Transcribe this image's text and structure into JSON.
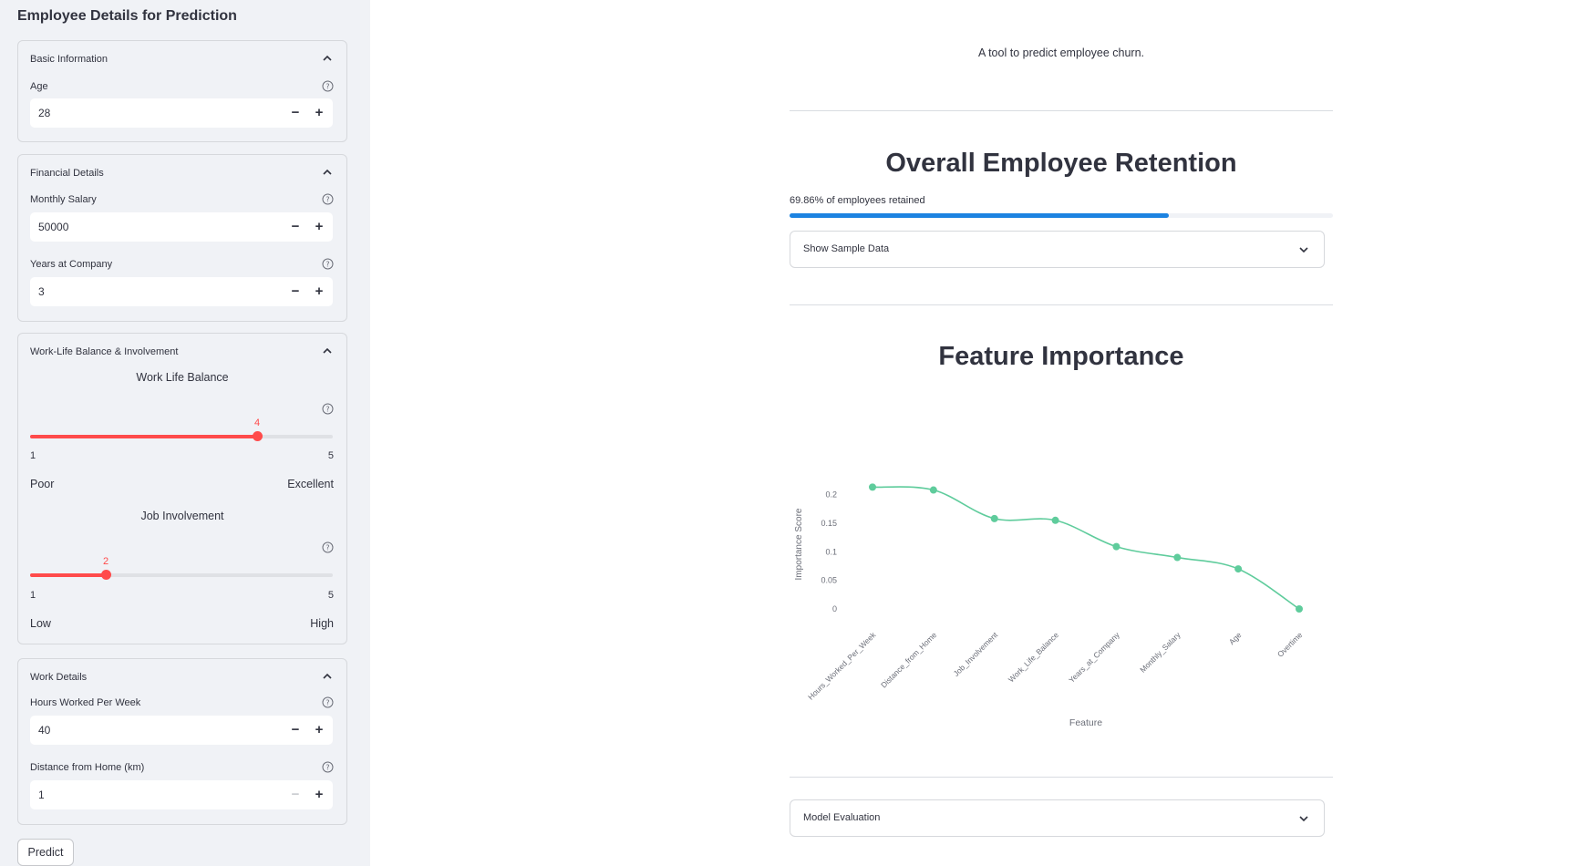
{
  "sidebar": {
    "title": "Employee Details for Prediction",
    "basic": {
      "header": "Basic Information",
      "age": {
        "label": "Age",
        "value": "28"
      }
    },
    "financial": {
      "header": "Financial Details",
      "salary": {
        "label": "Monthly Salary",
        "value": "50000"
      },
      "years": {
        "label": "Years at Company",
        "value": "3"
      }
    },
    "wlb": {
      "header": "Work-Life Balance & Involvement",
      "balance": {
        "title": "Work Life Balance",
        "value": 4,
        "min": 1,
        "max": 5,
        "min_caption": "Poor",
        "max_caption": "Excellent"
      },
      "involvement": {
        "title": "Job Involvement",
        "value": 2,
        "min": 1,
        "max": 5,
        "min_caption": "Low",
        "max_caption": "High"
      }
    },
    "work": {
      "header": "Work Details",
      "hours": {
        "label": "Hours Worked Per Week",
        "value": "40"
      },
      "distance": {
        "label": "Distance from Home (km)",
        "value": "1"
      }
    },
    "predict_label": "Predict",
    "icons": {
      "help": "help-circle-icon",
      "chevron_up": "chevron-up-icon",
      "minus": "minus-icon",
      "plus": "plus-icon"
    }
  },
  "main": {
    "tagline": "A tool to predict employee churn.",
    "retention": {
      "heading": "Overall Employee Retention",
      "progress_text": "69.86% of employees retained",
      "progress_value": 0.6986
    },
    "sample_data_label": "Show Sample Data",
    "feature_heading": "Feature Importance",
    "model_eval_label": "Model Evaluation",
    "icons": {
      "chevron_down": "chevron-down-icon"
    }
  },
  "colors": {
    "accent": "#ff4b4b",
    "progress": "#1c83e1",
    "line": "#5fcc9c",
    "sidebar_bg": "#f0f2f6"
  },
  "chart_data": {
    "type": "line",
    "xlabel": "Feature",
    "ylabel": "Importance Score",
    "categories": [
      "Hours_Worked_Per_Week",
      "Distance_from_Home",
      "Job_Involvement",
      "Work_Life_Balance",
      "Years_at_Company",
      "Monthly_Salary",
      "Age",
      "Overtime"
    ],
    "values": [
      0.213,
      0.208,
      0.158,
      0.155,
      0.109,
      0.09,
      0.07,
      0.0
    ],
    "ylim": [
      0,
      0.22
    ],
    "yticks": [
      0,
      0.05,
      0.1,
      0.15,
      0.2
    ],
    "ytick_labels": [
      "0",
      "0.05",
      "0.1",
      "0.15",
      "0.2"
    ],
    "grid": false
  }
}
